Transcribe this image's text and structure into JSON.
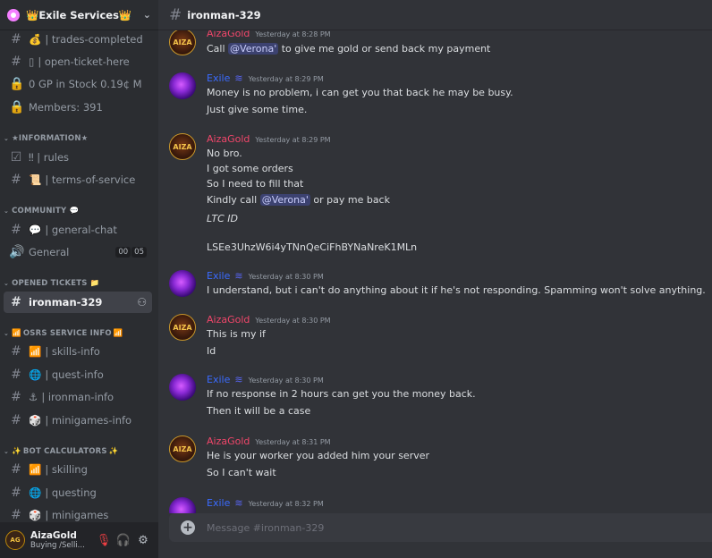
{
  "server": {
    "name": "👑Exile Services👑"
  },
  "channels": {
    "trades_completed": {
      "icon": "💰",
      "label": "| trades-completed"
    },
    "open_ticket": {
      "icon": "▯",
      "label": "| open-ticket-here"
    },
    "stock": {
      "label": "0 GP in Stock 0.19¢ M"
    },
    "members": {
      "label": "Members: 391"
    },
    "cat_information": "★INFORMATION★",
    "rules": {
      "label": "‼ | rules"
    },
    "tos": {
      "label": "| terms-of-service"
    },
    "cat_community": "COMMUNITY 💬",
    "general_chat": {
      "label": "| general-chat"
    },
    "general_voice": {
      "label": "General",
      "badge1": "00",
      "badge2": "05"
    },
    "cat_opened": "OPENED TICKETS 📁",
    "ironman": {
      "label": "ironman-329"
    },
    "cat_osrs": "OSRS SERVICE INFO",
    "skills_info": {
      "label": "| skills-info"
    },
    "quest_info": {
      "label": "| quest-info"
    },
    "ironman_info": {
      "label": "| ironman-info"
    },
    "minigames_info": {
      "label": "| minigames-info"
    },
    "cat_bot": "BOT CALCULATORS",
    "skilling": {
      "label": "| skilling"
    },
    "questing": {
      "label": "| questing"
    },
    "minigames": {
      "label": "| minigames"
    }
  },
  "user": {
    "name": "AizaGold",
    "status": "Buying /Selli..."
  },
  "header": {
    "channel": "ironman-329"
  },
  "messages": [
    {
      "author": "AizaGold",
      "time": "Yesterday at 8:28 PM",
      "lines": [
        "Call",
        "@Verona'",
        "to give me gold or send back my payment"
      ]
    },
    {
      "author": "Exile",
      "time": "Yesterday at 8:29 PM",
      "lines": [
        "Money is no problem, i can get you that back he may be busy.",
        "Just give some time."
      ]
    },
    {
      "author": "AizaGold",
      "time": "Yesterday at 8:29 PM",
      "lines": [
        "No bro.",
        "I got some orders",
        "So I need to  fill that",
        "Kindly call",
        "@Verona'",
        "or pay me back",
        "LTC ID",
        "LSEe3UhzW6i4yTNnQeCiFhBYNaNreK1MLn"
      ]
    },
    {
      "author": "Exile",
      "time": "Yesterday at 8:30 PM",
      "lines": [
        "I understand, but i can't do anything about it if he's not responding. Spamming won't solve anything."
      ]
    },
    {
      "author": "AizaGold",
      "time": "Yesterday at 8:30 PM",
      "lines": [
        "This is my if",
        "Id"
      ]
    },
    {
      "author": "Exile",
      "time": "Yesterday at 8:30 PM",
      "lines": [
        "If no response in 2 hours can get you the money back.",
        "Then it will be a case"
      ]
    },
    {
      "author": "AizaGold",
      "time": "Yesterday at 8:31 PM",
      "lines": [
        "He is your worker you added him your server",
        "So I can't wait"
      ]
    },
    {
      "author": "Exile",
      "time": "Yesterday at 8:32 PM",
      "lines": []
    }
  ],
  "composer": {
    "placeholder": "Message #ironman-329"
  },
  "colors": {
    "aiza": "#f0466a",
    "exile": "#3a6bff",
    "accent": "#5865f2"
  }
}
